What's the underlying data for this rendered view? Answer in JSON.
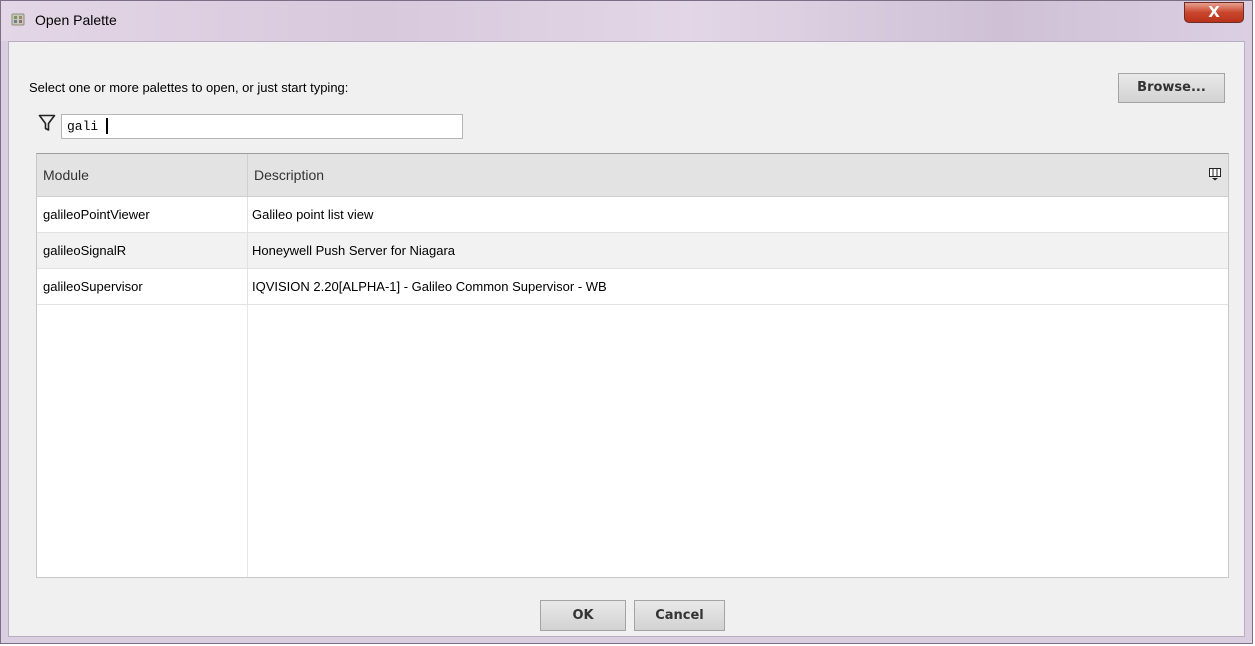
{
  "window": {
    "title": "Open Palette",
    "icon": "palette-app-icon",
    "close_label": "X"
  },
  "dialog": {
    "prompt": "Select one or more palettes to open, or just start typing:",
    "browse_label": "Browse...",
    "filter_value": "gali",
    "filter_icon": "filter-funnel-icon"
  },
  "table": {
    "columns": [
      "Module",
      "Description"
    ],
    "rows": [
      {
        "module": "galileoPointViewer",
        "description": "Galileo point list view"
      },
      {
        "module": "galileoSignalR",
        "description": "Honeywell Push Server for Niagara"
      },
      {
        "module": "galileoSupervisor",
        "description": "IQVISION 2.20[ALPHA-1] - Galileo Common Supervisor - WB"
      }
    ]
  },
  "buttons": {
    "ok_label": "OK",
    "cancel_label": "Cancel"
  }
}
